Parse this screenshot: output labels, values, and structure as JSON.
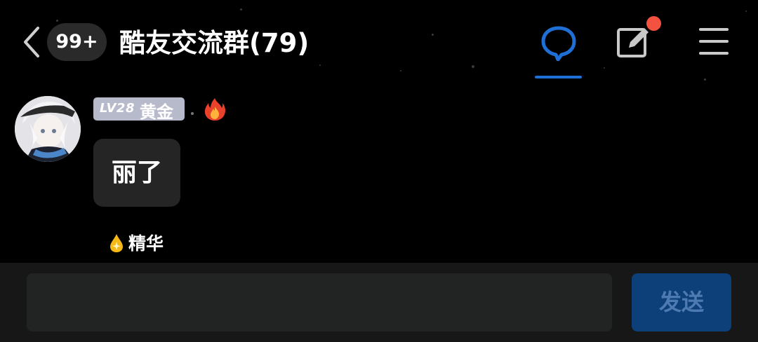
{
  "header": {
    "back_icon": "chevron-left-icon",
    "unread_badge": "99+",
    "title": "酷友交流群(79)",
    "chat_tab_icon": "chat-bubble-icon",
    "edit_icon": "edit-icon",
    "menu_icon": "menu-icon",
    "accent_color": "#1e6fd6",
    "notification_dot_color": "#f2523f"
  },
  "message": {
    "level": "LV28",
    "rank": "黄金",
    "fire_icon": "fire-icon",
    "text": "丽了",
    "essence_icon": "droplet-icon",
    "essence_label": "精华"
  },
  "composer": {
    "input_value": "",
    "send_label": "发送",
    "send_color": "#0d3f78"
  }
}
